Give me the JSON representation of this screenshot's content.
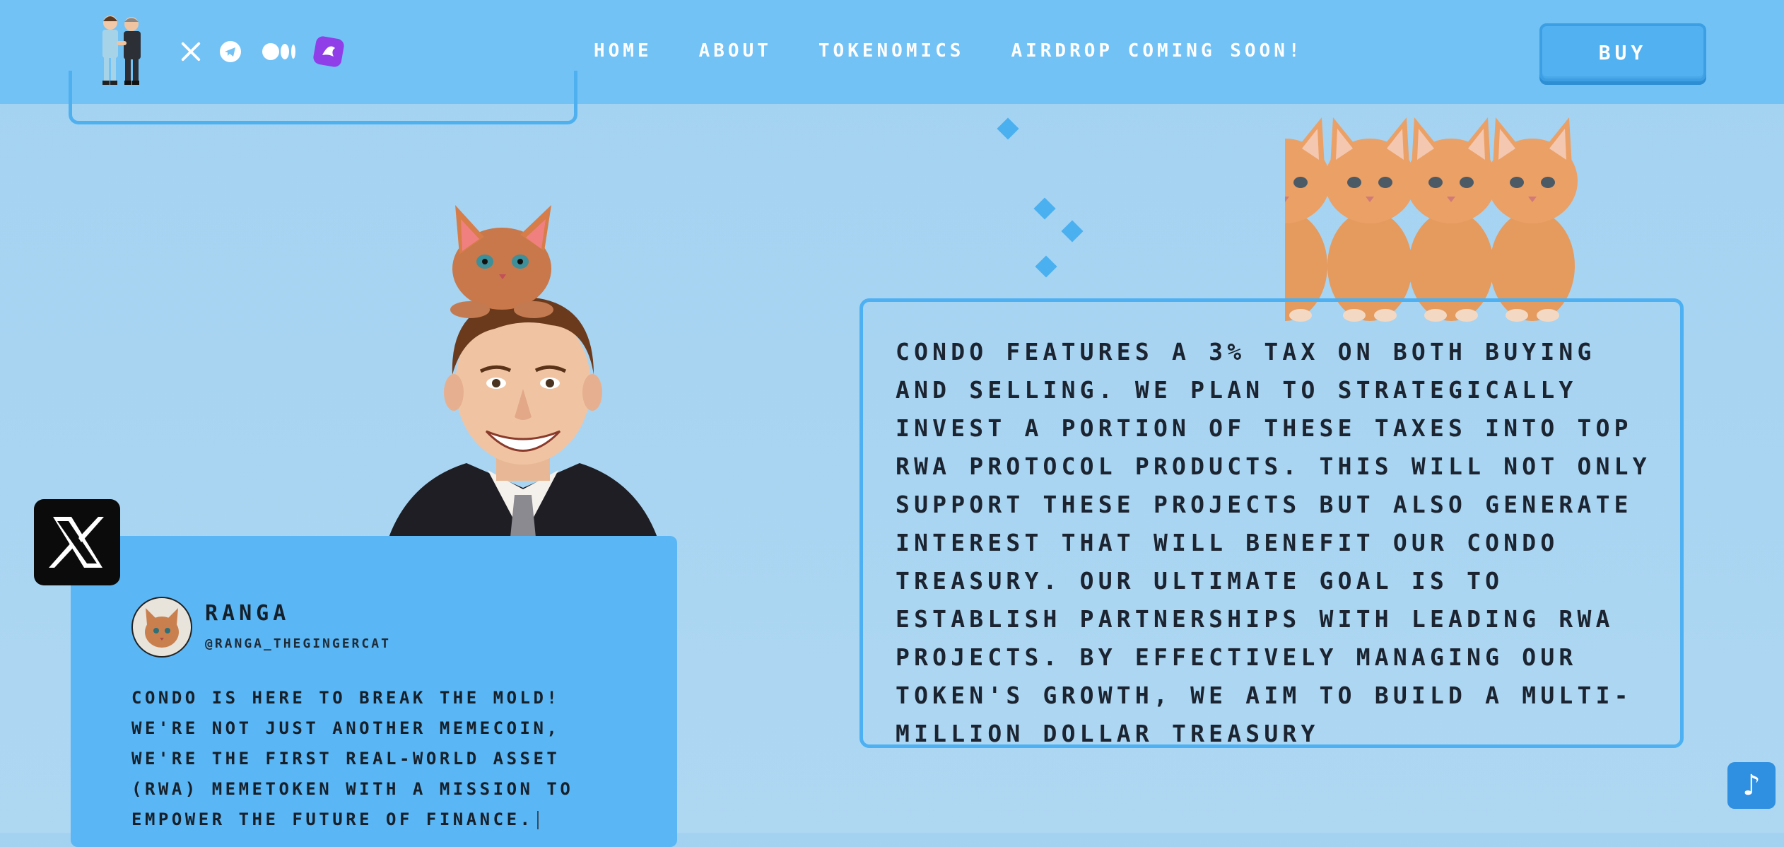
{
  "nav": {
    "links": [
      "HOME",
      "ABOUT",
      "TOKENOMICS",
      "AIRDROP COMING SOON!"
    ],
    "buy_label": "BUY",
    "socials": [
      "x-icon",
      "telegram-icon",
      "medium-icon",
      "dexscreener-icon"
    ]
  },
  "tweet": {
    "name": "RANGA",
    "handle": "@RANGA_THEGINGERCAT",
    "text": "CONDO IS HERE TO BREAK THE MOLD! WE'RE NOT JUST ANOTHER MEMECOIN, WE'RE THE FIRST REAL-WORLD ASSET (RWA) MEMETOKEN WITH A MISSION TO EMPOWER THE FUTURE OF FINANCE."
  },
  "treasury": {
    "text": "CONDO FEATURES A 3% TAX ON BOTH BUYING AND SELLING. WE PLAN TO STRATEGICALLY INVEST A PORTION OF THESE TAXES INTO TOP RWA PROTOCOL PRODUCTS. THIS WILL NOT ONLY SUPPORT THESE PROJECTS BUT ALSO GENERATE INTEREST THAT WILL BENEFIT OUR CONDO TREASURY. OUR ULTIMATE GOAL IS TO ESTABLISH PARTNERSHIPS WITH LEADING RWA PROJECTS. BY EFFECTIVELY MANAGING OUR TOKEN'S GROWTH, WE AIM TO BUILD A MULTI-MILLION DOLLAR TREASURY"
  },
  "music_label": "♪",
  "colors": {
    "nav_bg": "#72c2f6",
    "page_bg": "#a3d2f1",
    "accent": "#4cb0f2",
    "card_bg": "#5ab6f4",
    "text_dark": "#1b2430"
  }
}
